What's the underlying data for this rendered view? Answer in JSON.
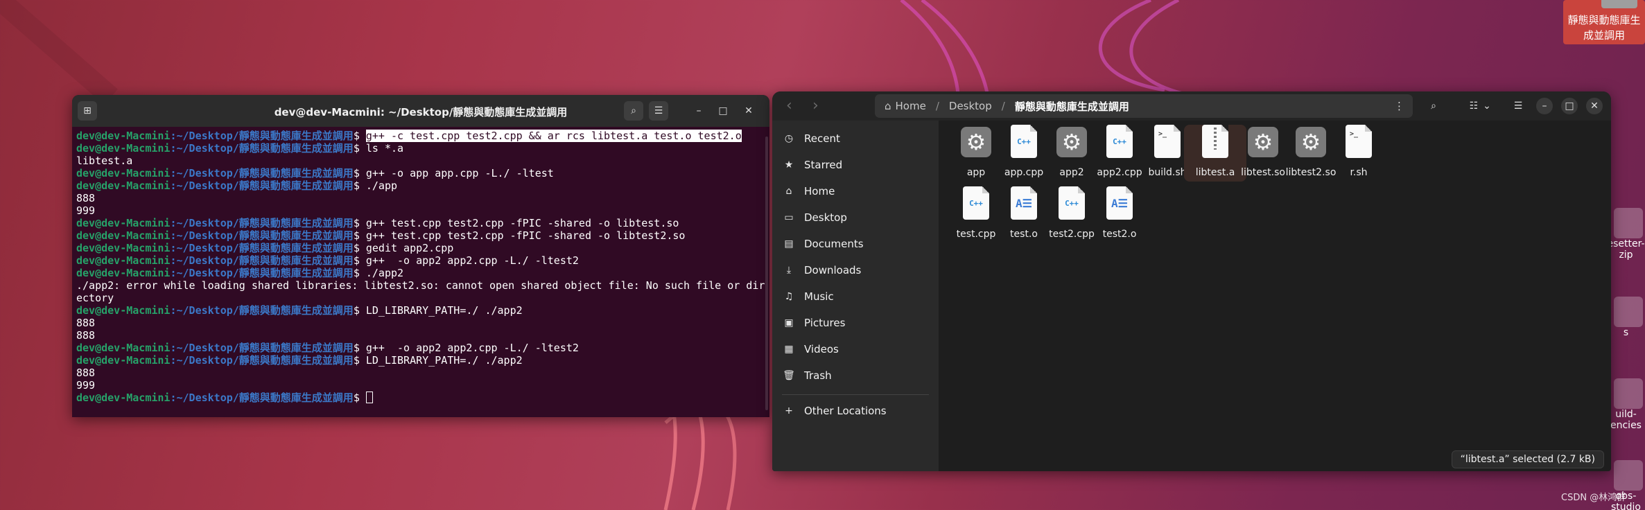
{
  "terminal": {
    "title": "dev@dev-Macmini: ~/Desktop/靜態與動態庫生成並調用",
    "prompt_user": "dev@dev-Macmini",
    "prompt_path": ":~/Desktop/靜態與動態庫生成並調用",
    "prompt_end": "$ ",
    "lines": [
      {
        "type": "cmd",
        "text": "g++ -c test.cpp test2.cpp && ar rcs libtest.a test.o test2.o",
        "highlight": true
      },
      {
        "type": "cmd",
        "text": "ls *.a"
      },
      {
        "type": "out",
        "text": "libtest.a"
      },
      {
        "type": "cmd",
        "text": "g++ -o app app.cpp -L./ -ltest"
      },
      {
        "type": "cmd",
        "text": "./app"
      },
      {
        "type": "out",
        "text": "888"
      },
      {
        "type": "out",
        "text": "999"
      },
      {
        "type": "cmd",
        "text": "g++ test.cpp test2.cpp -fPIC -shared -o libtest.so"
      },
      {
        "type": "cmd",
        "text": "g++ test.cpp test2.cpp -fPIC -shared -o libtest2.so"
      },
      {
        "type": "cmd",
        "text": "gedit app2.cpp"
      },
      {
        "type": "cmd",
        "text": "g++  -o app2 app2.cpp -L./ -ltest2"
      },
      {
        "type": "cmd",
        "text": "./app2"
      },
      {
        "type": "out",
        "text": "./app2: error while loading shared libraries: libtest2.so: cannot open shared object file: No such file or dir"
      },
      {
        "type": "out",
        "text": "ectory"
      },
      {
        "type": "cmd",
        "text": "LD_LIBRARY_PATH=./ ./app2"
      },
      {
        "type": "out",
        "text": "888"
      },
      {
        "type": "out",
        "text": "888"
      },
      {
        "type": "cmd",
        "text": "g++  -o app2 app2.cpp -L./ -ltest2"
      },
      {
        "type": "cmd",
        "text": "LD_LIBRARY_PATH=./ ./app2"
      },
      {
        "type": "out",
        "text": "888"
      },
      {
        "type": "out",
        "text": "999"
      },
      {
        "type": "cmd",
        "text": "",
        "cursor": true
      }
    ]
  },
  "files": {
    "breadcrumb": {
      "home": "Home",
      "desktop": "Desktop",
      "current": "靜態與動態庫生成並調用"
    },
    "sidebar": [
      "Recent",
      "Starred",
      "Home",
      "Desktop",
      "Documents",
      "Downloads",
      "Music",
      "Pictures",
      "Videos",
      "Trash"
    ],
    "other_locations": "Other Locations",
    "items": [
      {
        "name": "app",
        "kind": "exec"
      },
      {
        "name": "app.cpp",
        "kind": "cpp"
      },
      {
        "name": "app2",
        "kind": "exec"
      },
      {
        "name": "app2.cpp",
        "kind": "cpp"
      },
      {
        "name": "build.sh",
        "kind": "sh"
      },
      {
        "name": "libtest.a",
        "kind": "zip",
        "selected": true
      },
      {
        "name": "libtest.so",
        "kind": "exec"
      },
      {
        "name": "libtest2.so",
        "kind": "exec"
      },
      {
        "name": "r.sh",
        "kind": "sh"
      },
      {
        "name": "test.cpp",
        "kind": "cpp"
      },
      {
        "name": "test.o",
        "kind": "obj"
      },
      {
        "name": "test2.cpp",
        "kind": "cpp"
      },
      {
        "name": "test2.o",
        "kind": "obj"
      }
    ],
    "status": "“libtest.a” selected  (2.7 kB)"
  },
  "desktop": {
    "folder_label": "靜態與動態庫生成並調用",
    "items": [
      "esetter-zip",
      "s",
      "uild-encies",
      "obs-studio"
    ],
    "watermark": "CSDN @林鸿群"
  }
}
